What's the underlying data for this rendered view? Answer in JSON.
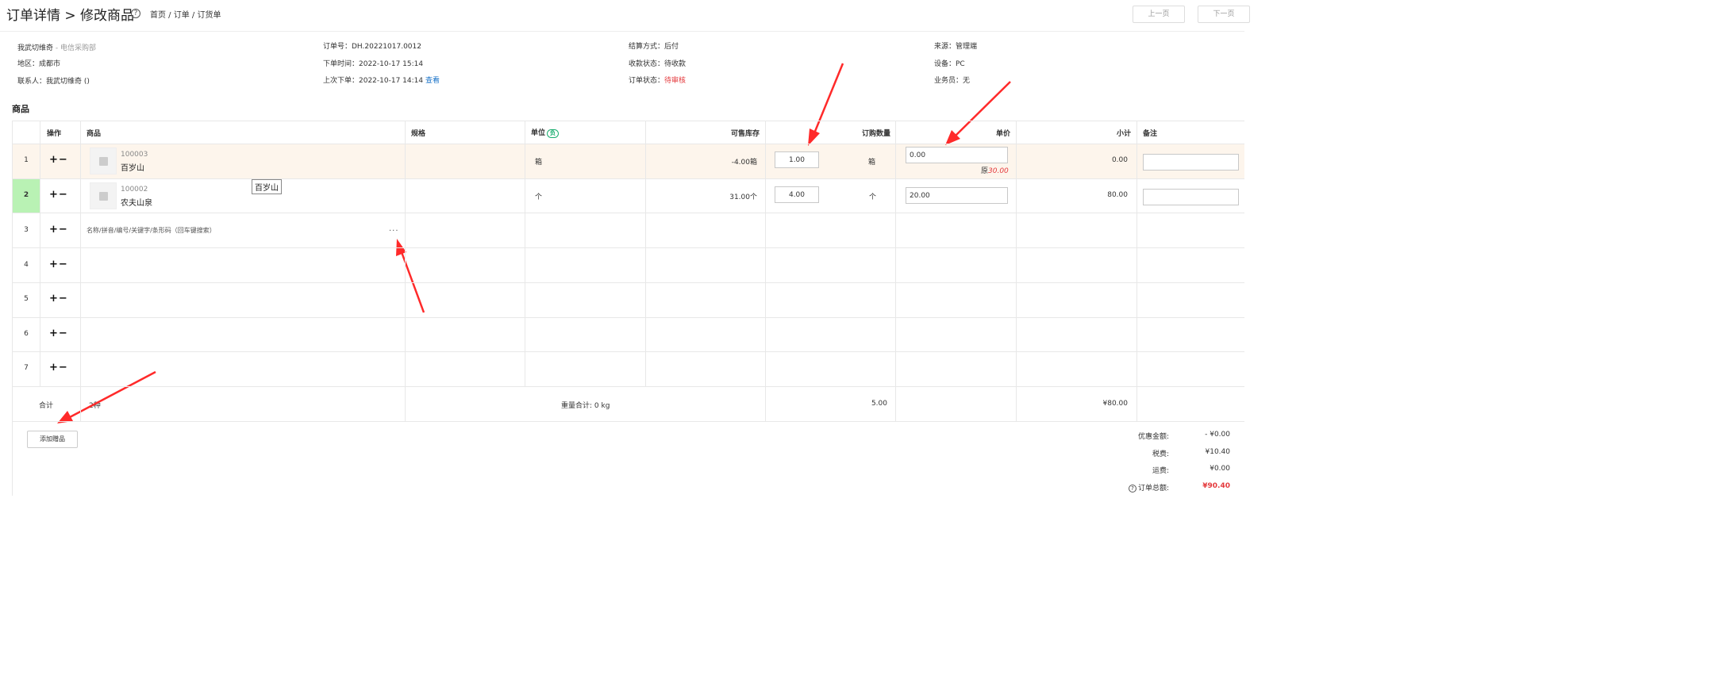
{
  "header": {
    "title": "订单详情 > 修改商品",
    "breadcrumb": "首页 / 订单 / 订货单",
    "prev_label": "上一页",
    "next_label": "下一页"
  },
  "info": {
    "customer": "我武切维奇",
    "customer_suffix": " - 电信采购部",
    "region": "地区：成都市",
    "contact": "联系人：我武切维奇  ()",
    "order_no": "订单号：DH.20221017.0012",
    "order_time": "下单时间：2022-10-17 15:14",
    "last_order": "上次下单：2022-10-17 14:14",
    "last_order_link": "查看",
    "settle": "结算方式：后付",
    "collect": "收款状态：待收款",
    "status_label": "订单状态：",
    "status_value": "待审核",
    "source": "来源：管理端",
    "device": "设备：PC",
    "salesman": "业务员：无"
  },
  "section_title": "商品",
  "table": {
    "headers": {
      "op": "操作",
      "product": "商品",
      "spec": "规格",
      "unit": "单位",
      "unit_badge": "负",
      "stock": "可售库存",
      "qty": "订购数量",
      "price": "单价",
      "subtotal": "小计",
      "remark": "备注"
    },
    "op_symbol": "+−",
    "rows": [
      {
        "num": "1",
        "code": "100003",
        "name": "百岁山",
        "unit": "箱",
        "stock": "-4.00箱",
        "qty": "1.00",
        "qty_unit": "箱",
        "price": "0.00",
        "orig_label": "原",
        "orig_price": "30.00",
        "subtotal": "0.00"
      },
      {
        "num": "2",
        "code": "100002",
        "name": "农夫山泉",
        "unit": "个",
        "stock": "31.00个",
        "qty": "4.00",
        "qty_unit": "个",
        "price": "20.00",
        "subtotal": "80.00"
      },
      {
        "num": "3",
        "hint": "名称/拼音/编号/关键字/条形码（回车键搜索）"
      },
      {
        "num": "4"
      },
      {
        "num": "5"
      },
      {
        "num": "6"
      },
      {
        "num": "7"
      }
    ],
    "tooltip": "百岁山",
    "ellipsis": "...",
    "footer": {
      "label": "合计",
      "count": "2种",
      "weight": "重量合计: 0 kg",
      "qty": "5.00",
      "amount": "¥80.00"
    }
  },
  "add_gift_label": "添加赠品",
  "summary": {
    "discount_label": "优惠金额:",
    "discount_value": "- ¥0.00",
    "tax_label": "税费:",
    "tax_value": "¥10.40",
    "shipping_label": "运费:",
    "shipping_value": "¥0.00",
    "total_label": "订单总额:",
    "total_value": "¥90.40"
  },
  "colors": {
    "accent_red": "#e4393c",
    "link_blue": "#1a73c8",
    "highlight_row": "#fdf5ec",
    "active_row_num": "#b9f2b4"
  }
}
